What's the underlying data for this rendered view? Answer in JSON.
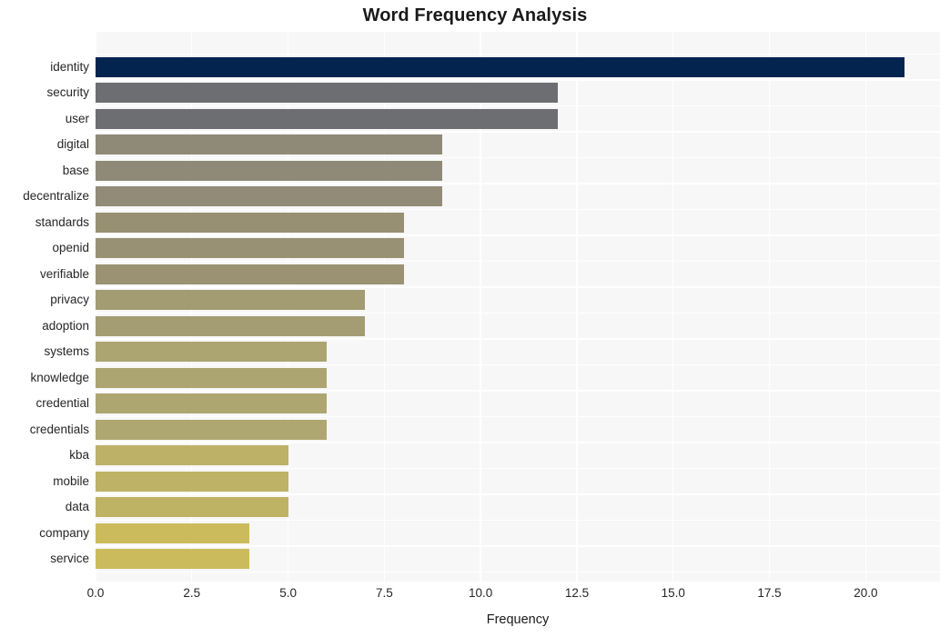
{
  "chart_data": {
    "type": "bar",
    "orientation": "horizontal",
    "title": "Word Frequency Analysis",
    "xlabel": "Frequency",
    "ylabel": "",
    "xlim": [
      0,
      21.93
    ],
    "xticks": [
      0.0,
      2.5,
      5.0,
      7.5,
      10.0,
      12.5,
      15.0,
      17.5,
      20.0
    ],
    "xtick_labels": [
      "0.0",
      "2.5",
      "5.0",
      "7.5",
      "10.0",
      "12.5",
      "15.0",
      "17.5",
      "20.0"
    ],
    "grid": true,
    "legend": null,
    "categories": [
      "identity",
      "security",
      "user",
      "digital",
      "base",
      "decentralize",
      "standards",
      "openid",
      "verifiable",
      "privacy",
      "adoption",
      "systems",
      "knowledge",
      "credential",
      "credentials",
      "kba",
      "mobile",
      "data",
      "company",
      "service"
    ],
    "values": [
      21,
      12,
      12,
      9,
      9,
      9,
      8,
      8,
      8,
      7,
      7,
      6,
      6,
      6,
      6,
      5,
      5,
      5,
      4,
      4
    ],
    "bar_colors": [
      "#042450",
      "#6c6e71",
      "#6c6e72",
      "#8f8977",
      "#8f8a77",
      "#918b78",
      "#989073",
      "#999173",
      "#9a9273",
      "#a39b72",
      "#a49c72",
      "#aca471",
      "#ada571",
      "#aea671",
      "#afa771",
      "#bcb167",
      "#bdb266",
      "#beb365",
      "#ccbb5c",
      "#ccbb5c"
    ],
    "plot_background": "#f7f7f7",
    "grid_color": "#ffffff",
    "figure_background": "#ffffff"
  }
}
